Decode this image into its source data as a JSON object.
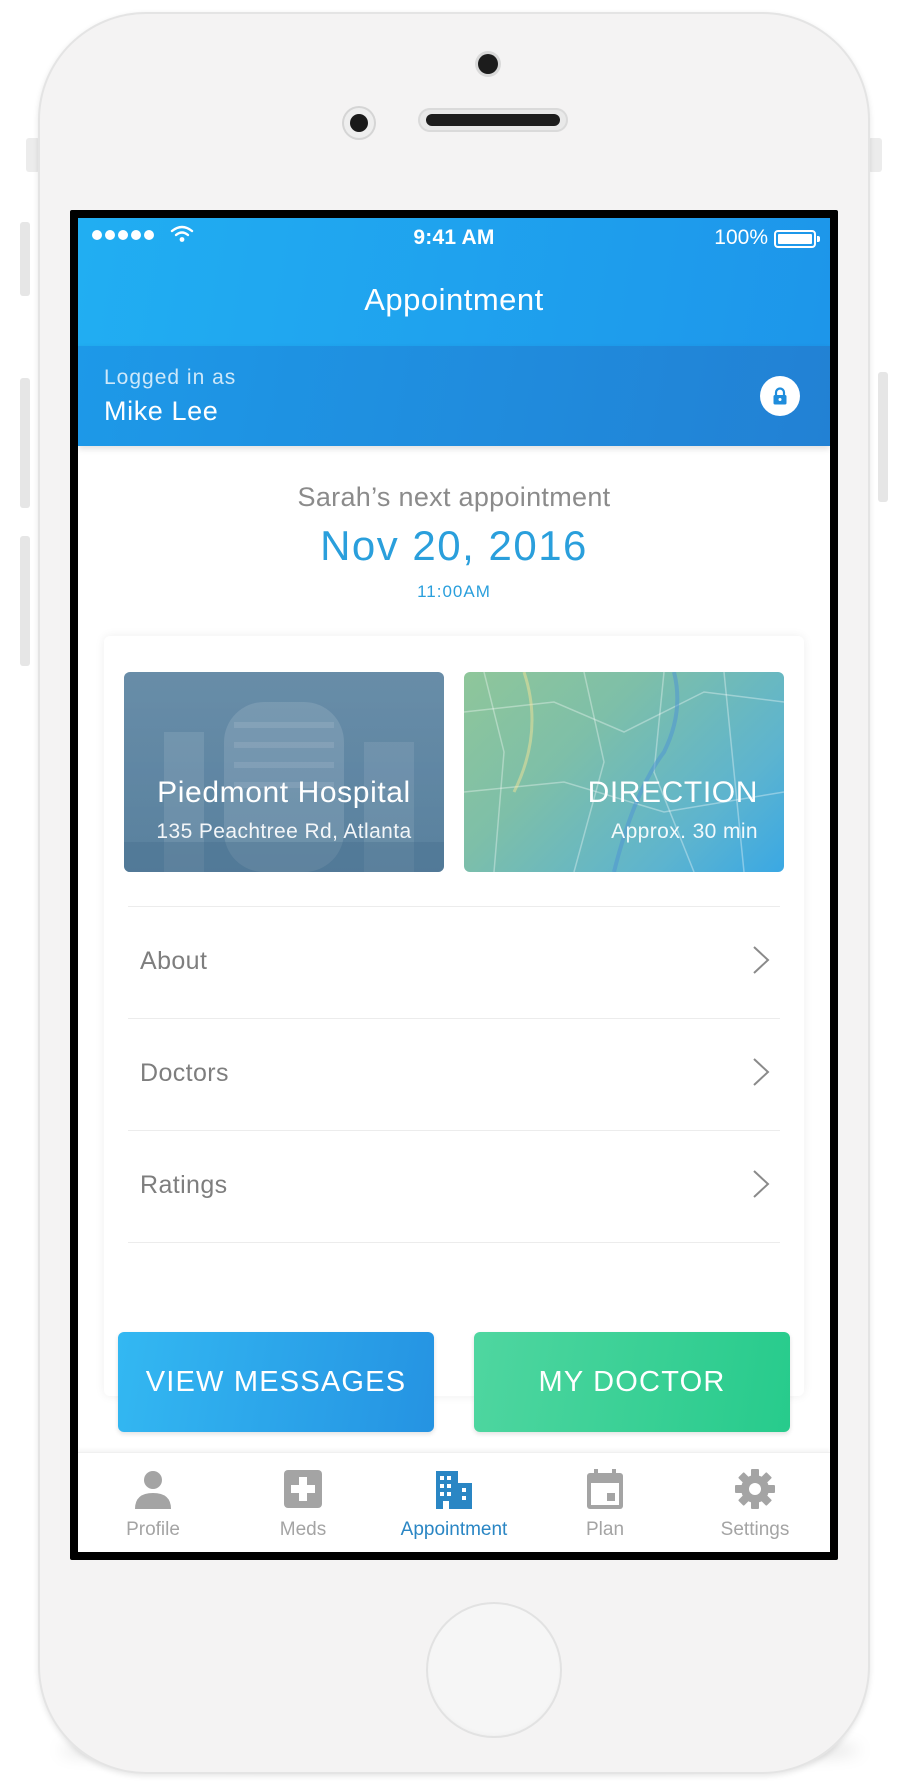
{
  "status_bar": {
    "time": "9:41 AM",
    "battery": "100%"
  },
  "header": {
    "title": "Appointment"
  },
  "login": {
    "caption": "Logged in as",
    "name": "Mike Lee"
  },
  "appointment": {
    "subtitle": "Sarah’s next appointment",
    "date": "Nov 20, 2016",
    "time": "11:00AM"
  },
  "tiles": {
    "hospital": {
      "title": "Piedmont Hospital",
      "subtitle": "135 Peachtree Rd, Atlanta"
    },
    "direction": {
      "title": "DIRECTION",
      "subtitle": "Approx. 30 min"
    }
  },
  "menu": {
    "items": [
      {
        "label": "About"
      },
      {
        "label": "Doctors"
      },
      {
        "label": "Ratings"
      }
    ]
  },
  "buttons": {
    "messages": "VIEW MESSAGES",
    "doctor": "MY DOCTOR"
  },
  "tab_bar": {
    "items": [
      {
        "label": "Profile",
        "icon": "person-icon"
      },
      {
        "label": "Meds",
        "icon": "medical-cross-icon"
      },
      {
        "label": "Appointment",
        "icon": "building-icon",
        "active": true
      },
      {
        "label": "Plan",
        "icon": "calendar-icon"
      },
      {
        "label": "Settings",
        "icon": "gear-icon"
      }
    ]
  },
  "colors": {
    "header_blue": "#1d96ea",
    "accent_blue": "#2a9fdc",
    "messages_button": "#2593e2",
    "doctor_button": "#27cb8c",
    "active_tab": "#2a86c4",
    "inactive_tab": "#a4a4a4"
  }
}
